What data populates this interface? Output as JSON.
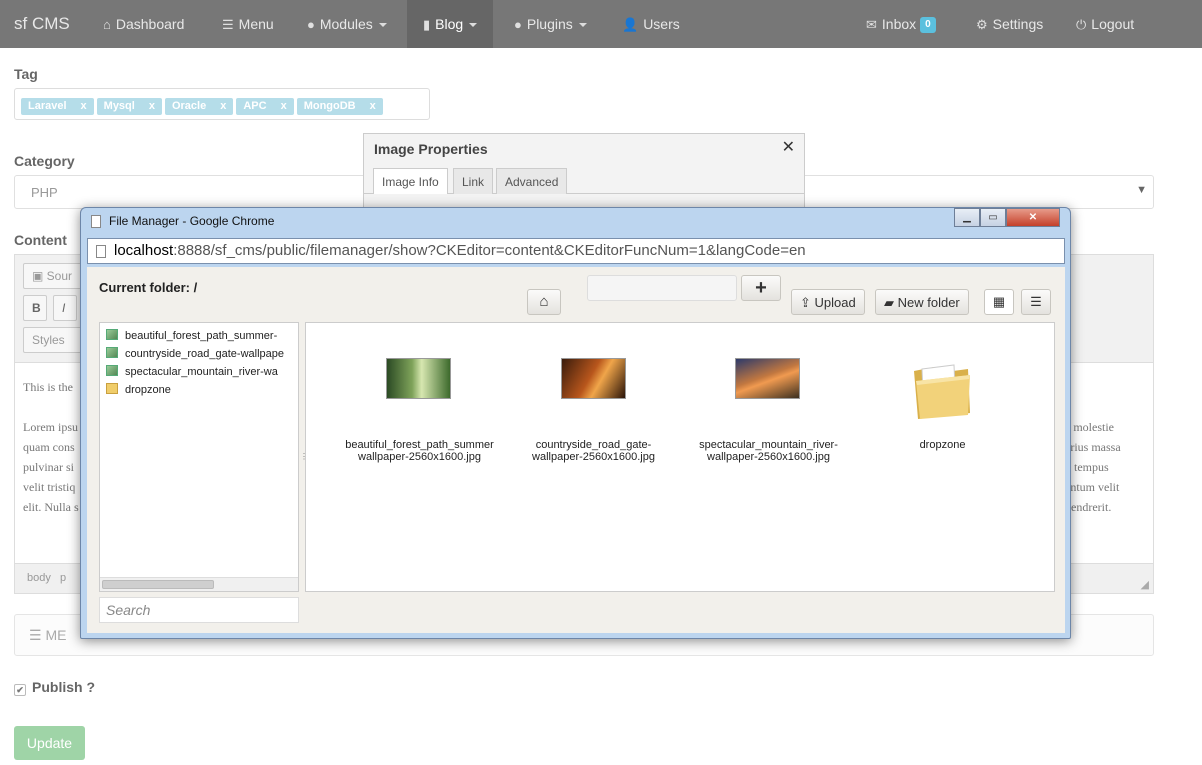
{
  "navbar": {
    "brand": "sf CMS",
    "items": [
      {
        "label": "Dashboard",
        "icon": "home-icon"
      },
      {
        "label": "Menu",
        "icon": "list-icon"
      },
      {
        "label": "Modules",
        "icon": "drop-icon"
      },
      {
        "label": "Blog",
        "icon": "book-icon"
      },
      {
        "label": "Plugins",
        "icon": "drop-icon"
      },
      {
        "label": "Users",
        "icon": "user-icon"
      },
      {
        "label": "Inbox",
        "icon": "envelope-icon",
        "badge": "0"
      },
      {
        "label": "Settings",
        "icon": "gear-icon"
      },
      {
        "label": "Logout",
        "icon": "power-icon"
      }
    ]
  },
  "form": {
    "tag_label": "Tag",
    "tags": [
      "Laravel",
      "Mysql",
      "Oracle",
      "APC",
      "MongoDB"
    ],
    "tag_remove": "x",
    "category_label": "Category",
    "category_value": "PHP",
    "content_label": "Content",
    "editor": {
      "source_label": "Sour",
      "bold_label": "B",
      "italic_label": "I",
      "styles_label": "Styles",
      "left_lines": [
        "This is the",
        "",
        "Lorem ipsu",
        "quam cons",
        "pulvinar si",
        "velit tristiq",
        "elit. Nulla s"
      ],
      "right_lines": [
        "a molestie",
        "arius massa",
        "d tempus",
        "entum velit",
        "hendrerit."
      ],
      "path_body": "body",
      "path_p": "p"
    },
    "meta_label": "ME",
    "publish_label": "Publish ?",
    "update_label": "Update"
  },
  "image_dialog": {
    "title": "Image Properties",
    "close": "✕",
    "tabs": [
      "Image Info",
      "Link",
      "Advanced"
    ]
  },
  "chrome_window": {
    "title": "File Manager - Google Chrome",
    "url_host": "localhost",
    "url_rest": ":8888/sf_cms/public/filemanager/show?CKEditor=content&CKEditorFuncNum=1&langCode=en"
  },
  "file_manager": {
    "current_folder_label": "Current folder:",
    "current_folder": "/",
    "upload_label": "Upload",
    "new_folder_label": "New folder",
    "search_placeholder": "Search",
    "tree": [
      {
        "name": "beautiful_forest_path_summer-",
        "type": "image"
      },
      {
        "name": "countryside_road_gate-wallpape",
        "type": "image"
      },
      {
        "name": "spectacular_mountain_river-wa",
        "type": "image"
      },
      {
        "name": "dropzone",
        "type": "folder"
      }
    ],
    "files": [
      {
        "line1": "beautiful_forest_path_summer",
        "line2": "wallpaper-2560x1600.jpg",
        "type": "image"
      },
      {
        "line1": "countryside_road_gate-",
        "line2": "wallpaper-2560x1600.jpg",
        "type": "image"
      },
      {
        "line1": "spectacular_mountain_river-",
        "line2": "wallpaper-2560x1600.jpg",
        "type": "image"
      },
      {
        "line1": "dropzone",
        "line2": "",
        "type": "folder"
      }
    ]
  }
}
